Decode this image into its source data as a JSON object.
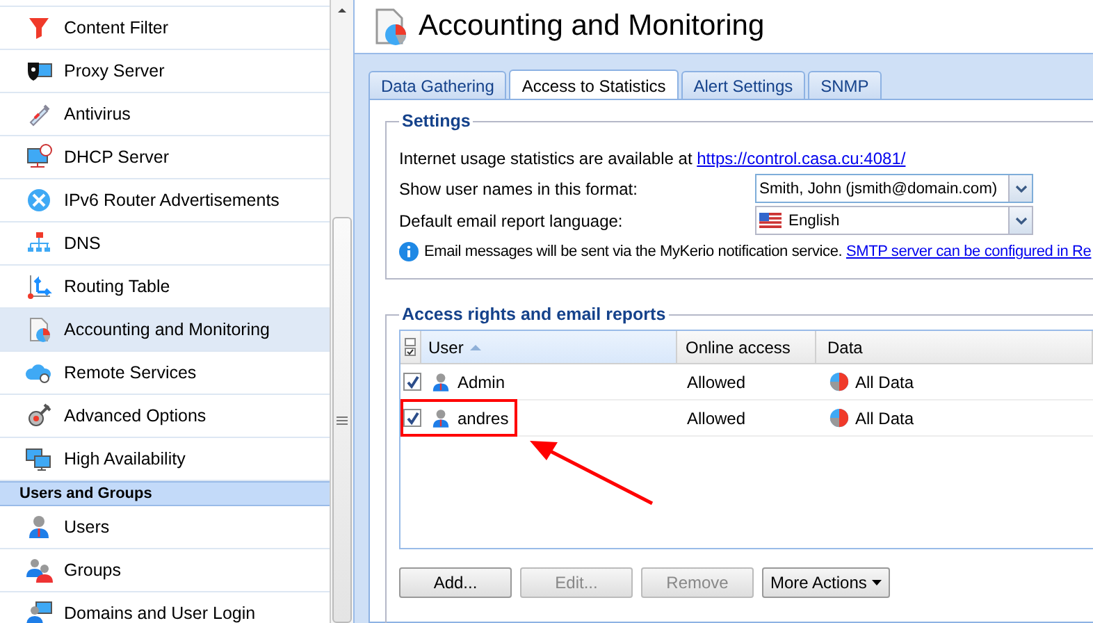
{
  "sidebar": {
    "sections": [
      {
        "items": [
          {
            "label": "Content Filter",
            "selected": false
          },
          {
            "label": "Proxy Server",
            "selected": false
          },
          {
            "label": "Antivirus",
            "selected": false
          },
          {
            "label": "DHCP Server",
            "selected": false
          },
          {
            "label": "IPv6 Router Advertisements",
            "selected": false
          },
          {
            "label": "DNS",
            "selected": false
          },
          {
            "label": "Routing Table",
            "selected": false
          },
          {
            "label": "Accounting and Monitoring",
            "selected": true
          },
          {
            "label": "Remote Services",
            "selected": false
          },
          {
            "label": "Advanced Options",
            "selected": false
          },
          {
            "label": "High Availability",
            "selected": false
          }
        ]
      },
      {
        "header": "Users and Groups",
        "items": [
          {
            "label": "Users",
            "selected": false
          },
          {
            "label": "Groups",
            "selected": false
          },
          {
            "label": "Domains and User Login",
            "selected": false
          }
        ]
      }
    ]
  },
  "page": {
    "title": "Accounting and Monitoring"
  },
  "tabs": [
    {
      "label": "Data Gathering",
      "selected": false
    },
    {
      "label": "Access to Statistics",
      "selected": true
    },
    {
      "label": "Alert Settings",
      "selected": false
    },
    {
      "label": "SNMP",
      "selected": false
    }
  ],
  "settings": {
    "legend": "Settings",
    "stats_text": "Internet usage statistics are available at",
    "stats_link": "https://control.casa.cu:4081/",
    "fields": [
      {
        "label": "Show user names in this format:",
        "value": "Smith, John (jsmith@domain.com)",
        "kind": "plain",
        "focused": true
      },
      {
        "label": "Default email report language:",
        "value": "English",
        "kind": "flag",
        "focused": false
      }
    ],
    "info": "Email messages will be sent via the MyKerio notification service.",
    "info_link": "SMTP server can be configured in Re"
  },
  "access": {
    "legend": "Access rights and email reports",
    "columns": [
      {
        "label": "User",
        "sorted": true
      },
      {
        "label": "Online access",
        "sorted": false
      },
      {
        "label": "Data",
        "sorted": false
      }
    ],
    "rows": [
      {
        "checked": true,
        "user": "Admin",
        "online_access": "Allowed",
        "data": "All Data",
        "highlighted": false
      },
      {
        "checked": true,
        "user": "andres",
        "online_access": "Allowed",
        "data": "All Data",
        "highlighted": true
      }
    ],
    "buttons": [
      {
        "label": "Add...",
        "disabled": false,
        "kind": "plain"
      },
      {
        "label": "Edit...",
        "disabled": true,
        "kind": "plain"
      },
      {
        "label": "Remove",
        "disabled": true,
        "kind": "plain"
      },
      {
        "label": "More Actions",
        "disabled": false,
        "kind": "menu"
      }
    ]
  }
}
